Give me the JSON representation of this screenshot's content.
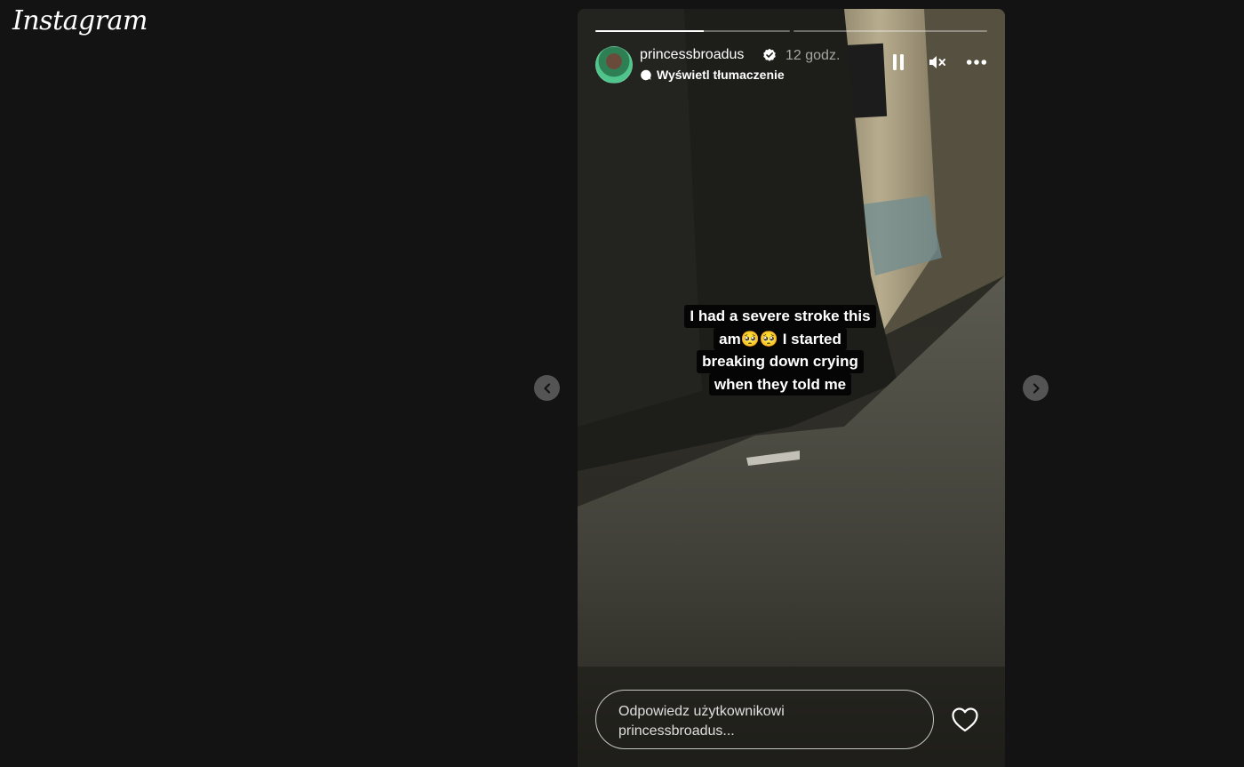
{
  "app": {
    "logo_text": "Instagram"
  },
  "story": {
    "progress_segments": [
      {
        "filled_fraction": 0.56
      },
      {
        "filled_fraction": 0.0
      }
    ],
    "user": {
      "username": "princessbroadus",
      "verified": true,
      "time_ago": "12 godz."
    },
    "translate_label": "Wyświetl tłumaczenie",
    "controls": {
      "pause_icon": "pause-icon",
      "mute_icon": "speaker-muted-icon",
      "more_icon": "more-options-icon"
    },
    "caption_lines": [
      "I had a severe stroke this",
      "am🥺🥺 I started",
      "breaking down crying",
      "when they told me"
    ],
    "reply_placeholder_line1": "Odpowiedz użytkownikowi",
    "reply_placeholder_line2": "princessbroadus...",
    "like_icon": "heart-icon"
  },
  "navigation": {
    "prev_icon": "chevron-left-icon",
    "next_icon": "chevron-right-icon"
  },
  "colors": {
    "page_background": "#131313",
    "caption_background": "#050505",
    "verified_badge": "#ffffff"
  }
}
